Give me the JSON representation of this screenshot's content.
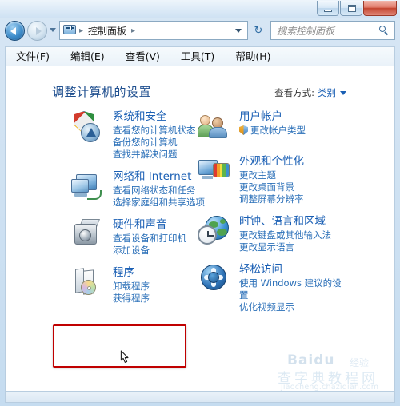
{
  "window": {
    "controls": {
      "minimize": "–",
      "maximize": "□",
      "close": "✕"
    }
  },
  "nav": {
    "back_tooltip": "后退",
    "forward_tooltip": "前进",
    "address_icon": "control-panel-icon",
    "breadcrumb": [
      "控制面板"
    ],
    "refresh_glyph": "↻",
    "search": {
      "placeholder": "搜索控制面板",
      "value": ""
    }
  },
  "menubar": {
    "items": [
      "文件(F)",
      "编辑(E)",
      "查看(V)",
      "工具(T)",
      "帮助(H)"
    ]
  },
  "main": {
    "title": "调整计算机的设置",
    "view_by": {
      "label": "查看方式:",
      "value": "类别"
    }
  },
  "categories": {
    "left": [
      {
        "icon": "security-shield-icon",
        "title": "系统和安全",
        "links": [
          "查看您的计算机状态",
          "备份您的计算机",
          "查找并解决问题"
        ]
      },
      {
        "icon": "network-internet-icon",
        "title": "网络和 Internet",
        "links": [
          "查看网络状态和任务",
          "选择家庭组和共享选项"
        ]
      },
      {
        "icon": "hardware-sound-icon",
        "title": "硬件和声音",
        "links": [
          "查看设备和打印机",
          "添加设备"
        ]
      },
      {
        "icon": "programs-icon",
        "title": "程序",
        "links": [
          "卸载程序",
          "获得程序"
        ],
        "highlighted": true
      }
    ],
    "right": [
      {
        "icon": "user-accounts-icon",
        "title": "用户帐户",
        "links": [
          "更改帐户类型"
        ],
        "shield_on_first_link": true
      },
      {
        "icon": "appearance-personalization-icon",
        "title": "外观和个性化",
        "links": [
          "更改主题",
          "更改桌面背景",
          "调整屏幕分辨率"
        ]
      },
      {
        "icon": "clock-language-region-icon",
        "title": "时钟、语言和区域",
        "links": [
          "更改键盘或其他输入法",
          "更改显示语言"
        ]
      },
      {
        "icon": "ease-of-access-icon",
        "title": "轻松访问",
        "links": [
          "使用 Windows 建议的设置",
          "优化视频显示"
        ]
      }
    ]
  },
  "watermark": {
    "brand": "Baidu",
    "brand_suffix": "经验",
    "site": "查字典教程网",
    "url": "jiaocheng.chazidian.com"
  },
  "colors": {
    "link": "#2a6fb8",
    "heading": "#1a5fb4",
    "highlight_border": "#c00000",
    "title_text": "#1f4f8f"
  }
}
